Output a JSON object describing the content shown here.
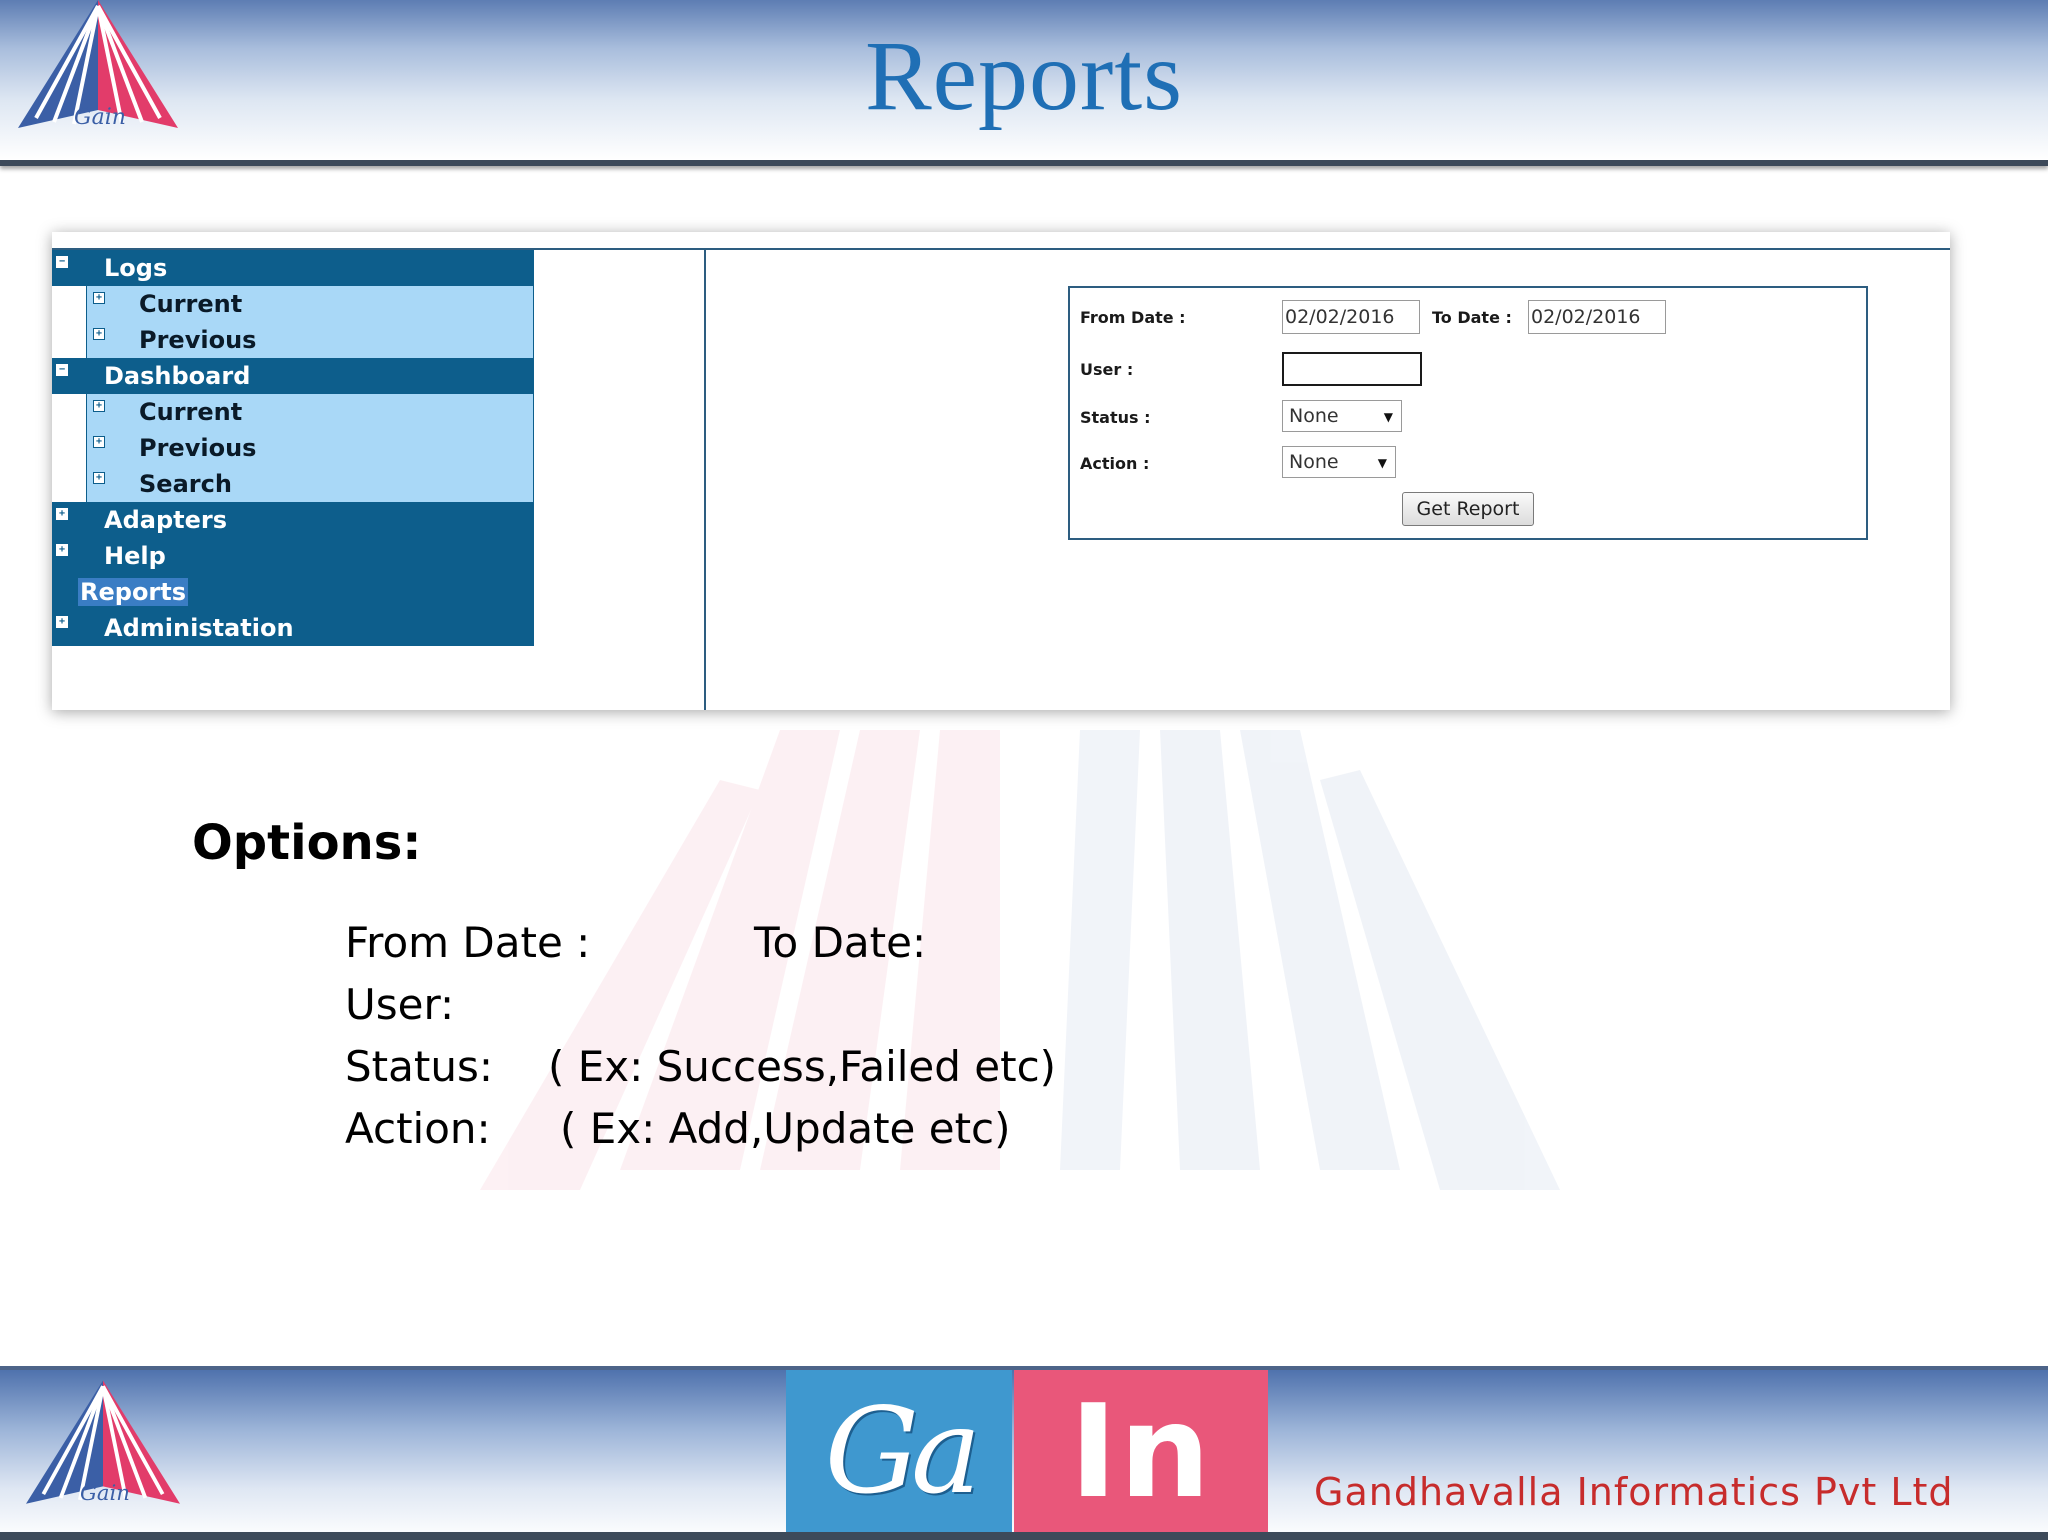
{
  "header": {
    "title": "Reports",
    "logo_text": "Gain"
  },
  "nav": {
    "items": [
      {
        "label": "Logs",
        "level": 0,
        "toggle": "−"
      },
      {
        "label": "Current",
        "level": 1,
        "toggle": "+"
      },
      {
        "label": "Previous",
        "level": 1,
        "toggle": "+"
      },
      {
        "label": "Dashboard",
        "level": 0,
        "toggle": "−"
      },
      {
        "label": "Current",
        "level": 1,
        "toggle": "+"
      },
      {
        "label": "Previous",
        "level": 1,
        "toggle": "+"
      },
      {
        "label": "Search",
        "level": 1,
        "toggle": "+"
      },
      {
        "label": "Adapters",
        "level": 0,
        "toggle": "+"
      },
      {
        "label": "Help",
        "level": 0,
        "toggle": "+"
      },
      {
        "label": "Reports",
        "level": 0,
        "toggle": "",
        "selected": true
      },
      {
        "label": "Administation",
        "level": 0,
        "toggle": "+"
      }
    ]
  },
  "form": {
    "from_date_label": "From Date :",
    "from_date_value": "02/02/2016",
    "to_date_label": "To Date :",
    "to_date_value": "02/02/2016",
    "user_label": "User :",
    "user_value": "",
    "status_label": "Status :",
    "status_value": "None",
    "action_label": "Action :",
    "action_value": "None",
    "submit_label": "Get Report"
  },
  "options": {
    "heading": "Options:",
    "from_date": "From Date :",
    "to_date": "To Date:",
    "user": "User:",
    "status": "Status:",
    "status_example": "( Ex: Success,Failed etc)",
    "action": "Action:",
    "action_example": "( Ex: Add,Update etc)"
  },
  "footer": {
    "brand_left": "Ga",
    "brand_right": "In",
    "company": "Gandhavalla Informatics Pvt Ltd",
    "logo_text": "Gain"
  },
  "colors": {
    "title": "#1f6fb5",
    "nav_parent": "#0d5e8c",
    "nav_child": "#a9d8f7",
    "brand_blue": "#3f98cf",
    "brand_pink": "#e9577a",
    "company_text": "#c72c2c"
  }
}
